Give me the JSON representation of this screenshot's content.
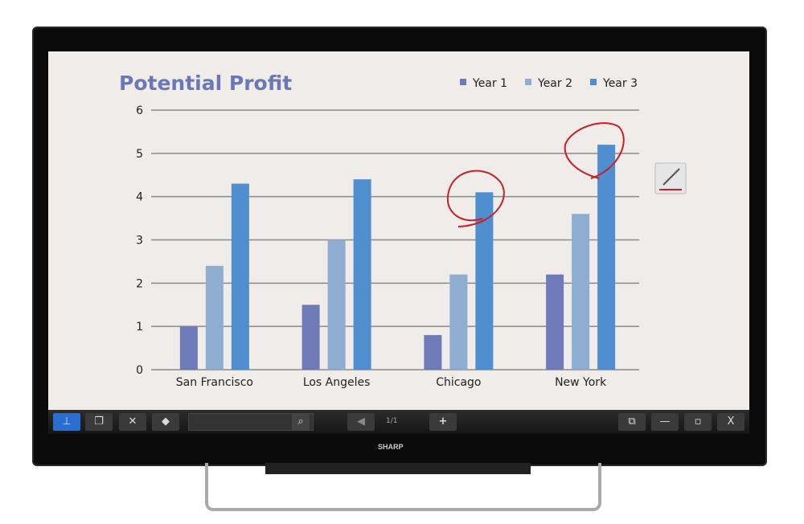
{
  "chart_data": {
    "type": "bar",
    "title": "Potential Profit",
    "categories": [
      "San Francisco",
      "Los Angeles",
      "Chicago",
      "New York"
    ],
    "series": [
      {
        "name": "Year 1",
        "values": [
          1.0,
          1.5,
          0.8,
          2.2
        ],
        "color": "#6f7bb8"
      },
      {
        "name": "Year 2",
        "values": [
          2.4,
          3.0,
          2.2,
          3.6
        ],
        "color": "#8fadd0"
      },
      {
        "name": "Year 3",
        "values": [
          4.3,
          4.4,
          4.1,
          5.2
        ],
        "color": "#4f8fd0"
      }
    ],
    "ylim": [
      0,
      6
    ],
    "yticks": [
      "0",
      "1",
      "2",
      "3",
      "4",
      "5",
      "6"
    ],
    "grid": true,
    "legend": "top-right",
    "annotations": [
      "red circle around Chicago Year 3",
      "red circle around New York Year 3"
    ]
  },
  "toolbar": {
    "buttons": [
      "pin-icon",
      "pages-icon",
      "tools-icon",
      "move-icon"
    ],
    "search_placeholder": "",
    "page_indicator": "1/1",
    "add_label": "+",
    "prev_label": "◀",
    "minimize_label": "—",
    "close_label": "X",
    "accent": "#2a6fd0"
  },
  "brand": "SHARP"
}
